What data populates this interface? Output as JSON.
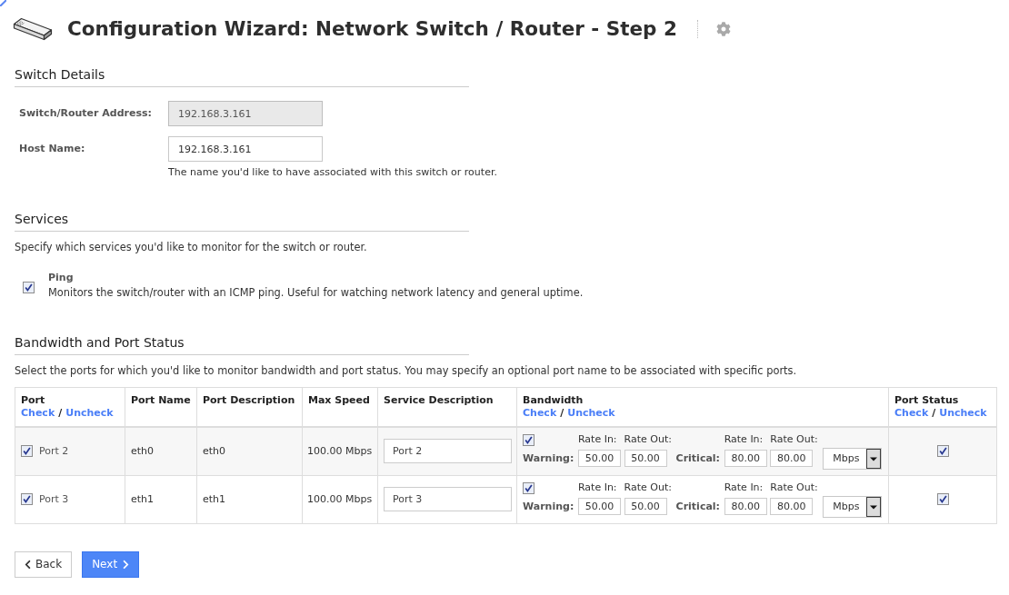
{
  "header": {
    "title": "Configuration Wizard: Network Switch / Router - Step 2"
  },
  "switch_details": {
    "heading": "Switch Details",
    "fields": [
      {
        "label": "Switch/Router Address:",
        "value": "192.168.3.161",
        "disabled": true
      },
      {
        "label": "Host Name:",
        "value": "192.168.3.161",
        "disabled": false,
        "help": "The name you'd like to have associated with this switch or router."
      }
    ]
  },
  "services": {
    "heading": "Services",
    "description": "Specify which services you'd like to monitor for the switch or router.",
    "items": [
      {
        "name": "Ping",
        "description": "Monitors the switch/router with an ICMP ping. Useful for watching network latency and general uptime.",
        "checked": true
      }
    ]
  },
  "bandwidth": {
    "heading": "Bandwidth and Port Status",
    "description": "Select the ports for which you'd like to monitor bandwidth and port status. You may specify an optional port name to be associated with specific ports.",
    "table": {
      "columns": [
        {
          "label": "Port",
          "check_link": "Check",
          "separator": "/",
          "uncheck_link": "Uncheck"
        },
        {
          "label": "Port Name"
        },
        {
          "label": "Port Description"
        },
        {
          "label": "Max Speed"
        },
        {
          "label": "Service Description"
        },
        {
          "label": "Bandwidth",
          "check_link": "Check",
          "separator": "/",
          "uncheck_link": "Uncheck"
        },
        {
          "label": "Port Status",
          "check_link": "Check",
          "separator": "/",
          "uncheck_link": "Uncheck"
        }
      ],
      "rows": [
        {
          "port": {
            "label": "Port 2",
            "checked": true
          },
          "port_name": "eth0",
          "port_description": "eth0",
          "max_speed": "100.00 Mbps",
          "service_description": "Port 2",
          "bandwidth": {
            "checked": true,
            "warning": {
              "label": "Warning:",
              "rate_in_label": "Rate In:",
              "rate_out_label": "Rate Out:",
              "rate_in": "50.00",
              "rate_out": "50.00"
            },
            "critical": {
              "label": "Critical:",
              "rate_in_label": "Rate In:",
              "rate_out_label": "Rate Out:",
              "rate_in": "80.00",
              "rate_out": "80.00"
            },
            "unit": "Mbps"
          },
          "port_status": {
            "checked": true
          }
        },
        {
          "port": {
            "label": "Port 3",
            "checked": true
          },
          "port_name": "eth1",
          "port_description": "eth1",
          "max_speed": "100.00 Mbps",
          "service_description": "Port 3",
          "bandwidth": {
            "checked": true,
            "warning": {
              "label": "Warning:",
              "rate_in_label": "Rate In:",
              "rate_out_label": "Rate Out:",
              "rate_in": "50.00",
              "rate_out": "50.00"
            },
            "critical": {
              "label": "Critical:",
              "rate_in_label": "Rate In:",
              "rate_out_label": "Rate Out:",
              "rate_in": "80.00",
              "rate_out": "80.00"
            },
            "unit": "Mbps"
          },
          "port_status": {
            "checked": true
          }
        }
      ]
    }
  },
  "buttons": [
    {
      "kind": "back",
      "label": "Back"
    },
    {
      "kind": "next",
      "label": "Next"
    }
  ]
}
